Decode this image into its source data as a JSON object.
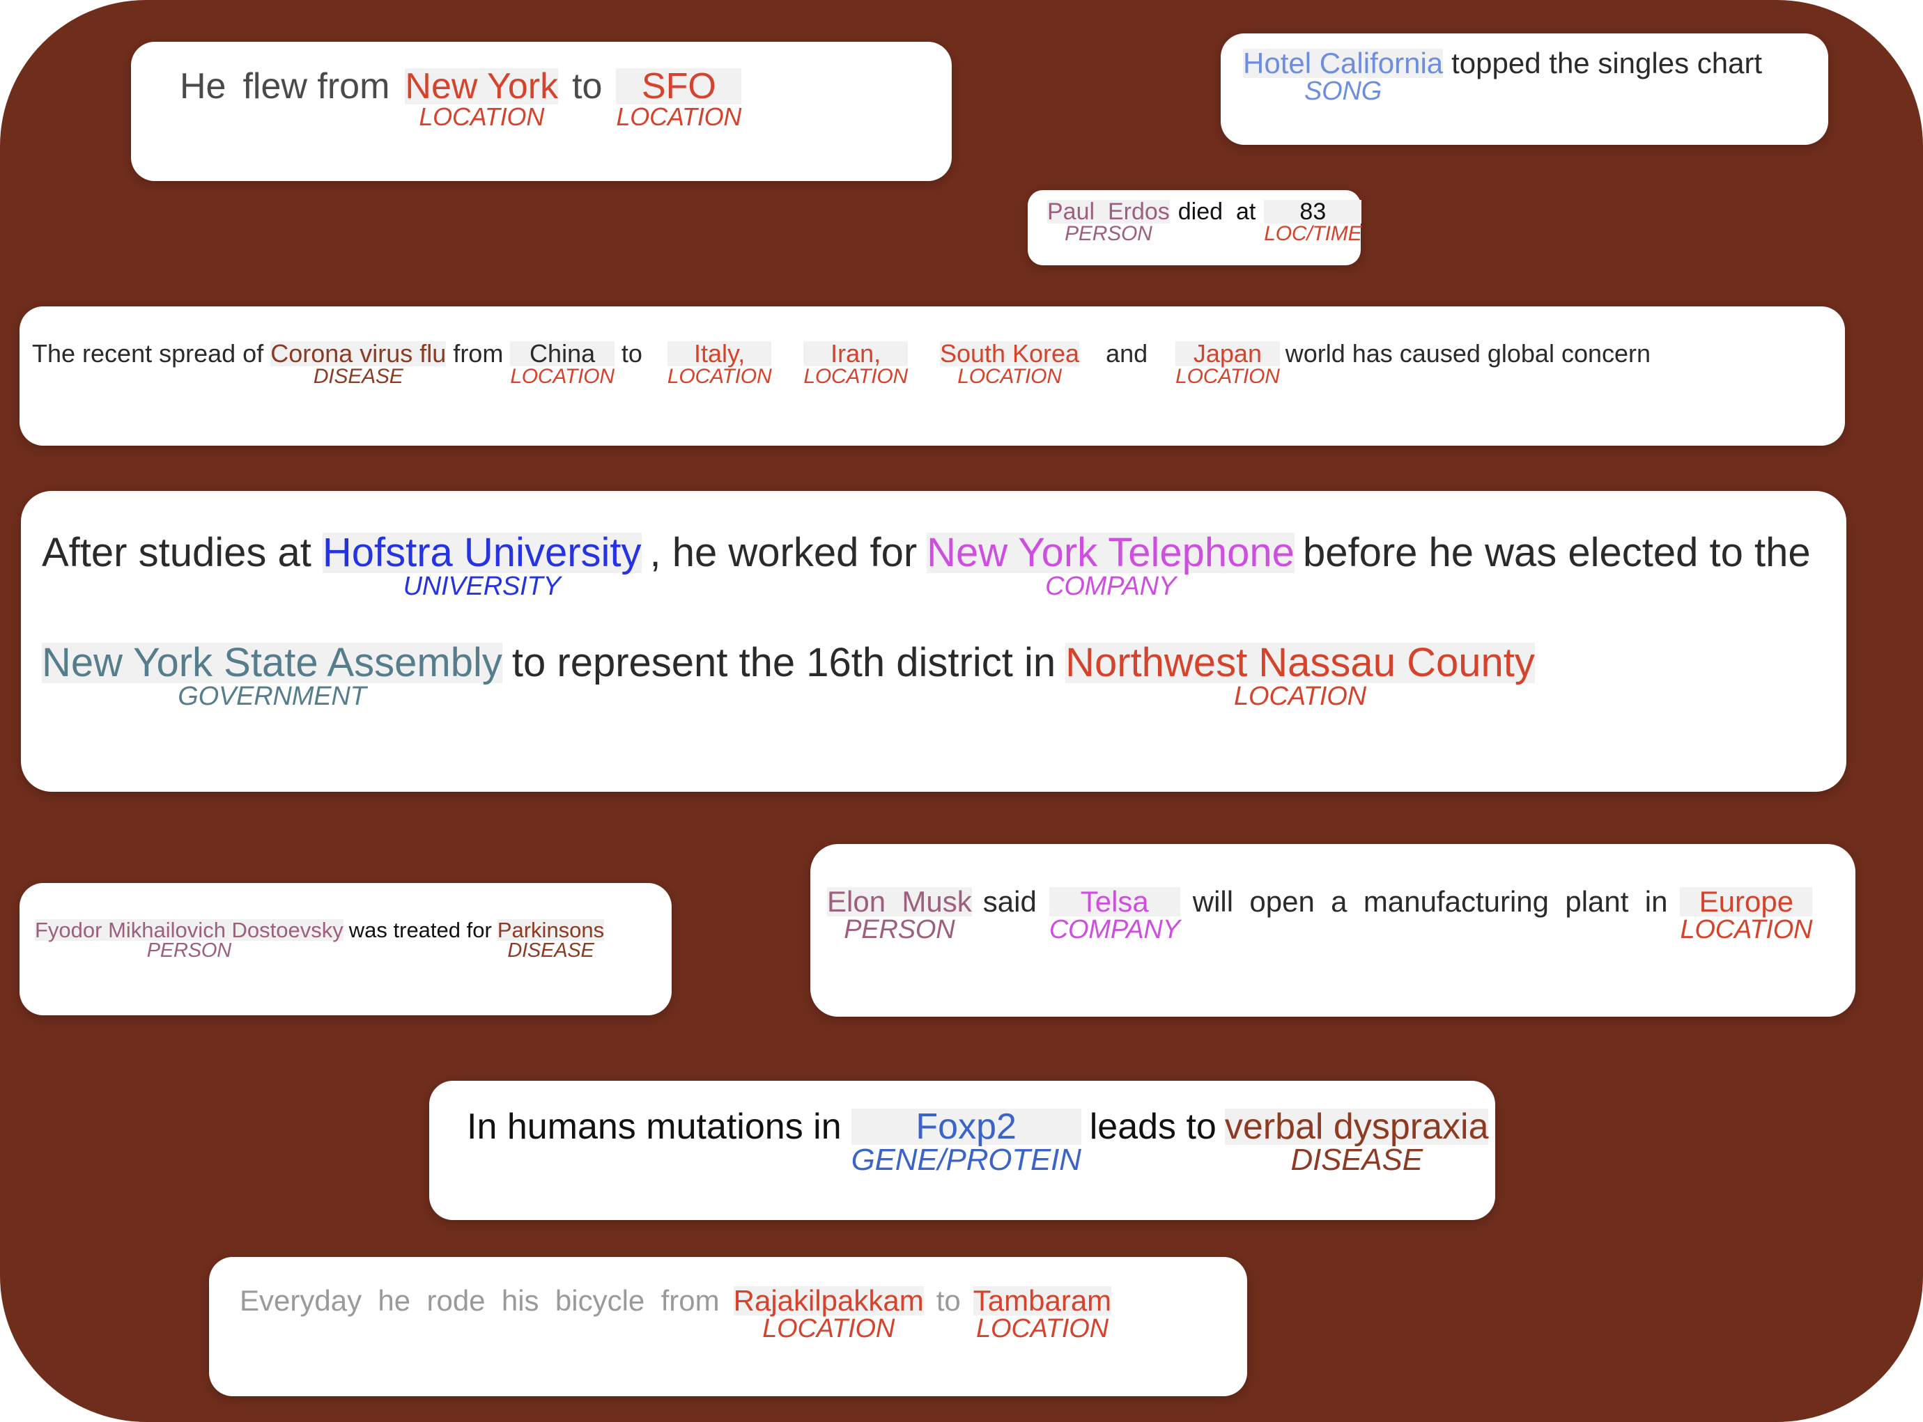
{
  "theme": {
    "backdrop_color": "#6F2D1C",
    "card_color": "#FFFFFF",
    "highlight_color": "#F1F1F1",
    "entity_colors": {
      "LOCATION": "#D6432C",
      "DISEASE": "#8C3A22",
      "PERSON": "#9C5F7E",
      "COMPANY": "#CE4EE0",
      "SONG": "#6D8DDE",
      "UNIVERSITY": "#2533E0",
      "GOVERNMENT": "#567D8C",
      "GENE/PROTEIN": "#3B63C8",
      "LOC/TIME": "#D6432C"
    }
  },
  "cards": {
    "flight": {
      "t0": "He",
      "t1": "flew from",
      "t2": "New York",
      "l2": "LOCATION",
      "t3": "to",
      "t4": "SFO",
      "l4": "LOCATION"
    },
    "song": {
      "t0": "Hotel California",
      "l0": "SONG",
      "t1": "topped the singles chart"
    },
    "erdos": {
      "t0": "Paul  Erdos",
      "l0": "PERSON",
      "t1": "died  at",
      "t2": "83",
      "l2": "LOC/TIME"
    },
    "corona": {
      "t0": "The recent spread of",
      "t1": "Corona virus flu",
      "l1": "DISEASE",
      "t2": "from",
      "t3": "China",
      "l3": "LOCATION",
      "t4": "to",
      "t5": "Italy,",
      "l5": "LOCATION",
      "t6": "Iran,",
      "l6": "LOCATION",
      "t7": "South Korea",
      "l7": "LOCATION",
      "t8": "and",
      "t9": "Japan",
      "l9": "LOCATION",
      "t10": "world has caused global concern"
    },
    "hofstra": {
      "t0": "After studies at",
      "t1": "Hofstra University",
      "l1": "UNIVERSITY",
      "t2": ", he worked for",
      "t3": "New York Telephone",
      "l3": "COMPANY",
      "t4": "before he was elected to the",
      "t5": "New York State Assembly",
      "l5": "GOVERNMENT",
      "t6": "to represent the 16th district in",
      "t7": "Northwest Nassau County",
      "l7": "LOCATION"
    },
    "dostoevsky": {
      "t0": "Fyodor Mikhailovich Dostoevsky",
      "l0": "PERSON",
      "t1": "was treated for",
      "t2": "Parkinsons",
      "l2": "DISEASE"
    },
    "musk": {
      "t0": "Elon  Musk",
      "l0": "PERSON",
      "t1": "said",
      "t2": "Telsa",
      "l2": "COMPANY",
      "t3": "will  open  a  manufacturing  plant  in",
      "t4": "Europe",
      "l4": "LOCATION"
    },
    "foxp2": {
      "t0": "In humans mutations in",
      "t1": "Foxp2",
      "l1": "GENE/PROTEIN",
      "t2": "leads to",
      "t3": "verbal dyspraxia",
      "l3": "DISEASE"
    },
    "bicycle": {
      "t0": "Everyday  he  rode  his  bicycle  from",
      "t1": "Rajakilpakkam",
      "l1": "LOCATION",
      "t2": "to",
      "t3": "Tambaram",
      "l3": "LOCATION"
    }
  }
}
